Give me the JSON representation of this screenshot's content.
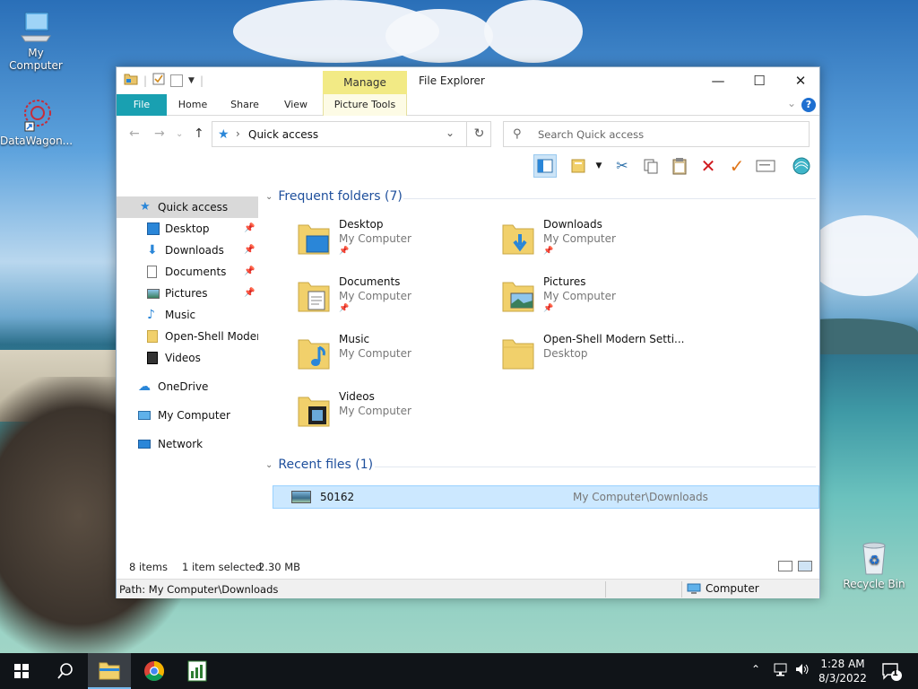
{
  "desktop": {
    "icons": [
      {
        "label": "My Computer"
      },
      {
        "label": "DataWagon..."
      },
      {
        "label": "Recycle Bin"
      }
    ]
  },
  "window": {
    "title": "File Explorer",
    "contextual_tab": "Manage",
    "ribbon_tabs": [
      "File",
      "Home",
      "Share",
      "View",
      "Picture Tools"
    ],
    "address": {
      "current": "Quick access"
    },
    "search": {
      "placeholder": "Search Quick access"
    }
  },
  "navigation": {
    "quick_access": "Quick access",
    "pinned": [
      "Desktop",
      "Downloads",
      "Documents",
      "Pictures"
    ],
    "others": [
      "Music",
      "Open-Shell Modern",
      "Videos"
    ],
    "onedrive": "OneDrive",
    "my_computer": "My Computer",
    "network": "Network"
  },
  "frequent": {
    "header": "Frequent folders (7)",
    "folders": [
      {
        "name": "Desktop",
        "location": "My Computer"
      },
      {
        "name": "Downloads",
        "location": "My Computer"
      },
      {
        "name": "Documents",
        "location": "My Computer"
      },
      {
        "name": "Pictures",
        "location": "My Computer"
      },
      {
        "name": "Music",
        "location": "My Computer"
      },
      {
        "name": "Open-Shell Modern Setti...",
        "location": "Desktop"
      },
      {
        "name": "Videos",
        "location": "My Computer"
      }
    ]
  },
  "recent": {
    "header": "Recent files (1)",
    "files": [
      {
        "name": "50162",
        "path": "My Computer\\Downloads"
      }
    ]
  },
  "status": {
    "items": "8 items",
    "selected": "1 item selected",
    "size": "2.30 MB"
  },
  "details_bar": {
    "path": "Path: My Computer\\Downloads",
    "location": "Computer"
  },
  "taskbar": {
    "time": "1:28 AM",
    "date": "8/3/2022",
    "notifications": "1"
  },
  "colors": {
    "file_tab": "#19a0b1",
    "manage_tab": "#f2ea85",
    "selection": "#cce8ff",
    "group_header": "#1e4f9c"
  }
}
